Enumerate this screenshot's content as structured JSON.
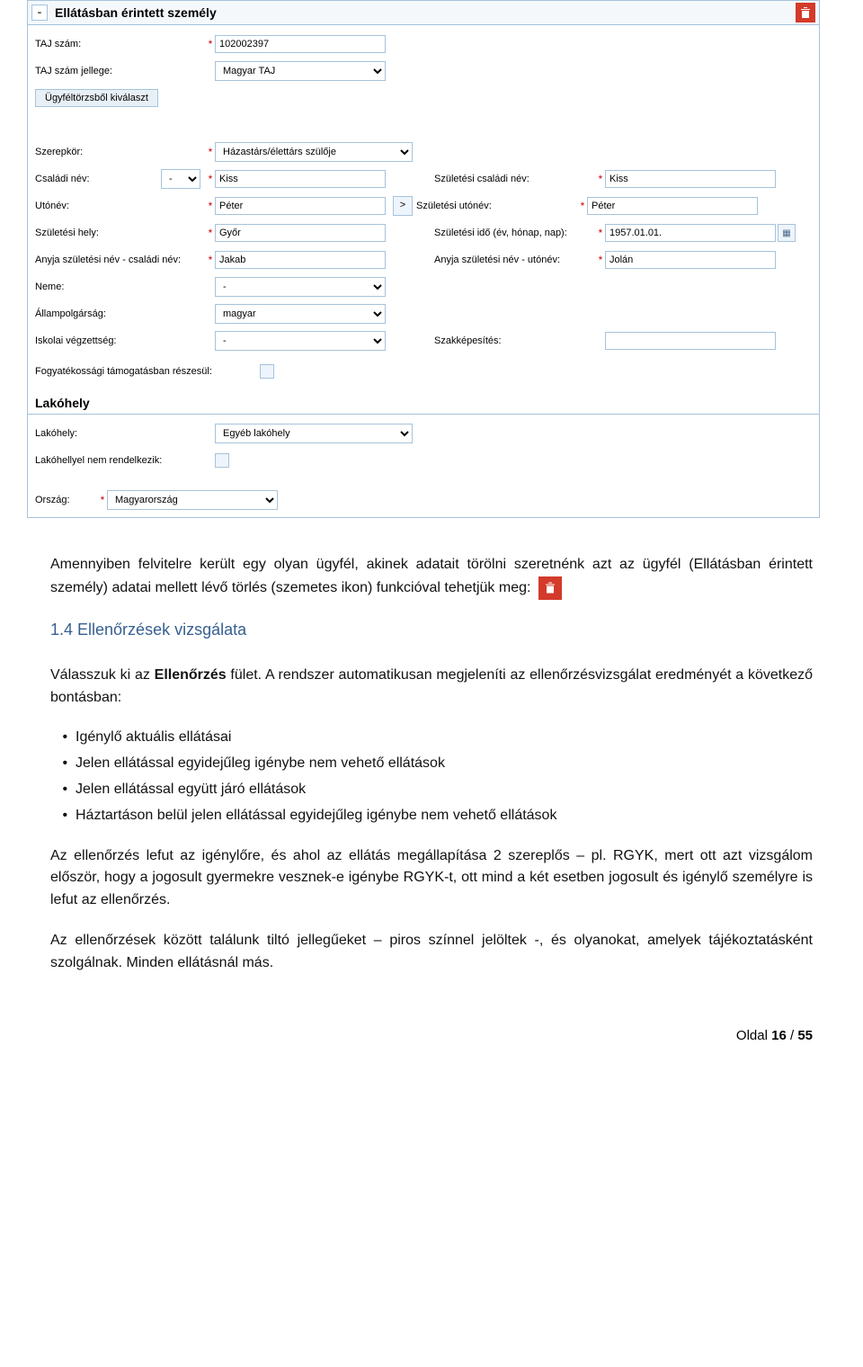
{
  "form": {
    "section1_title": "Ellátásban érintett személy",
    "collapse_glyph": "-",
    "taj_label": "TAJ szám:",
    "taj_value": "102002397",
    "tajjelleg_label": "TAJ szám jellege:",
    "tajjelleg_value": "Magyar TAJ",
    "select_client_btn": "Ügyféltörzsből kiválaszt",
    "szerepkor_label": "Szerepkör:",
    "szerepkor_value": "Házastárs/élettárs szülője",
    "csaladi_label": "Családi név:",
    "csaladi_prefix": "-",
    "csaladi_value": "Kiss",
    "right_szulcsaladi_label": "Születési családi név:",
    "right_szulcsaladi_value": "Kiss",
    "utonev_label": "Utónév:",
    "utonev_value": "Péter",
    "right_szuluto_label": "Születési utónév:",
    "right_szuluto_value": "Péter",
    "copy_btn": ">",
    "szulhely_label": "Születési hely:",
    "szulhely_value": "Győr",
    "right_szulido_label": "Születési idő (év, hónap, nap):",
    "right_szulido_value": "1957.01.01.",
    "anyacsaladi_label": "Anyja születési név - családi név:",
    "anyacsaladi_value": "Jakab",
    "right_anyauto_label": "Anyja születési név - utónév:",
    "right_anyauto_value": "Jolán",
    "neme_label": "Neme:",
    "neme_value": "-",
    "allampolg_label": "Állampolgárság:",
    "allampolg_value": "magyar",
    "iskola_label": "Iskolai végzettség:",
    "iskola_value": "-",
    "right_szakkep_label": "Szakképesítés:",
    "right_szakkep_value": "",
    "fogyat_label": "Fogyatékossági támogatásban részesül:",
    "section_lakohely": "Lakóhely",
    "lakohely_label": "Lakóhely:",
    "lakohely_value": "Egyéb lakóhely",
    "lakohely_nem_label": "Lakóhellyel nem rendelkezik:",
    "orszag_label": "Ország:",
    "orszag_value": "Magyarország",
    "calendar_glyph": "▦"
  },
  "doc": {
    "p1_a": "Amennyiben felvitelre került egy olyan ügyfél, akinek adatait törölni szeretnénk azt az ügyfél (Ellátásban érintett személy) adatai mellett lévő törlés (szemetes ikon) funkcióval tehetjük meg: ",
    "heading": "1.4   Ellenőrzések vizsgálata",
    "p2": "Válasszuk ki az Ellenőrzés fület. A rendszer automatikusan megjeleníti az ellenőrzésvizsgálat eredményét a következő bontásban:",
    "p2_part1": "Válasszuk ki az ",
    "p2_bold": "Ellenőrzés",
    "p2_part2": " fület. A rendszer automatikusan megjeleníti az ellenőrzésvizsgálat eredményét a következő bontásban:",
    "li1": "Igénylő aktuális ellátásai",
    "li2": "Jelen ellátással egyidejűleg igénybe nem vehető ellátások",
    "li3": "Jelen ellátással együtt járó ellátások",
    "li4": "Háztartáson belül jelen ellátással egyidejűleg igénybe nem vehető ellátások",
    "p3": "Az ellenőrzés lefut az igénylőre, és ahol az ellátás megállapítása 2 szereplős – pl. RGYK, mert ott azt vizsgálom először, hogy a jogosult gyermekre vesznek-e igénybe RGYK-t, ott mind a két esetben jogosult és igénylő személyre is lefut az ellenőrzés.",
    "p4": "Az ellenőrzések között találunk tiltó jellegűeket – piros színnel jelöltek -, és olyanokat, amelyek tájékoztatásként szolgálnak. Minden ellátásnál más."
  },
  "footer": {
    "label": "Oldal ",
    "cur": "16",
    "sep": " / ",
    "total": "55"
  }
}
